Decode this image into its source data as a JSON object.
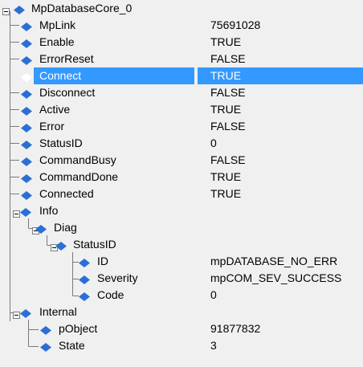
{
  "root": {
    "label": "MpDatabaseCore_0",
    "expanded": true
  },
  "rows": [
    {
      "label": "MpLink",
      "value": "75691028"
    },
    {
      "label": "Enable",
      "value": "TRUE"
    },
    {
      "label": "ErrorReset",
      "value": "FALSE"
    },
    {
      "label": "Connect",
      "value": "TRUE",
      "selected": true
    },
    {
      "label": "Disconnect",
      "value": "FALSE"
    },
    {
      "label": "Active",
      "value": "TRUE"
    },
    {
      "label": "Error",
      "value": "FALSE"
    },
    {
      "label": "StatusID",
      "value": "0"
    },
    {
      "label": "CommandBusy",
      "value": "FALSE"
    },
    {
      "label": "CommandDone",
      "value": "TRUE"
    },
    {
      "label": "Connected",
      "value": "TRUE"
    },
    {
      "label": "Info",
      "value": "",
      "expanded": true
    },
    {
      "label": "Diag",
      "value": "",
      "expanded": true
    },
    {
      "label": "StatusID",
      "value": "",
      "expanded": true
    },
    {
      "label": "ID",
      "value": "mpDATABASE_NO_ERR"
    },
    {
      "label": "Severity",
      "value": "mpCOM_SEV_SUCCESS"
    },
    {
      "label": "Code",
      "value": "0"
    },
    {
      "label": "Internal",
      "value": "",
      "expanded": true
    },
    {
      "label": "pObject",
      "value": "91877832"
    },
    {
      "label": "State",
      "value": "3"
    }
  ],
  "colors": {
    "background": "#f0f0f0",
    "selection": "#3399ff",
    "icon_fill": "#2b6fd6",
    "tree_lines": "#7a7a7a"
  },
  "icons": {
    "node": "diamond-icon",
    "expander": "minus-box-icon"
  }
}
